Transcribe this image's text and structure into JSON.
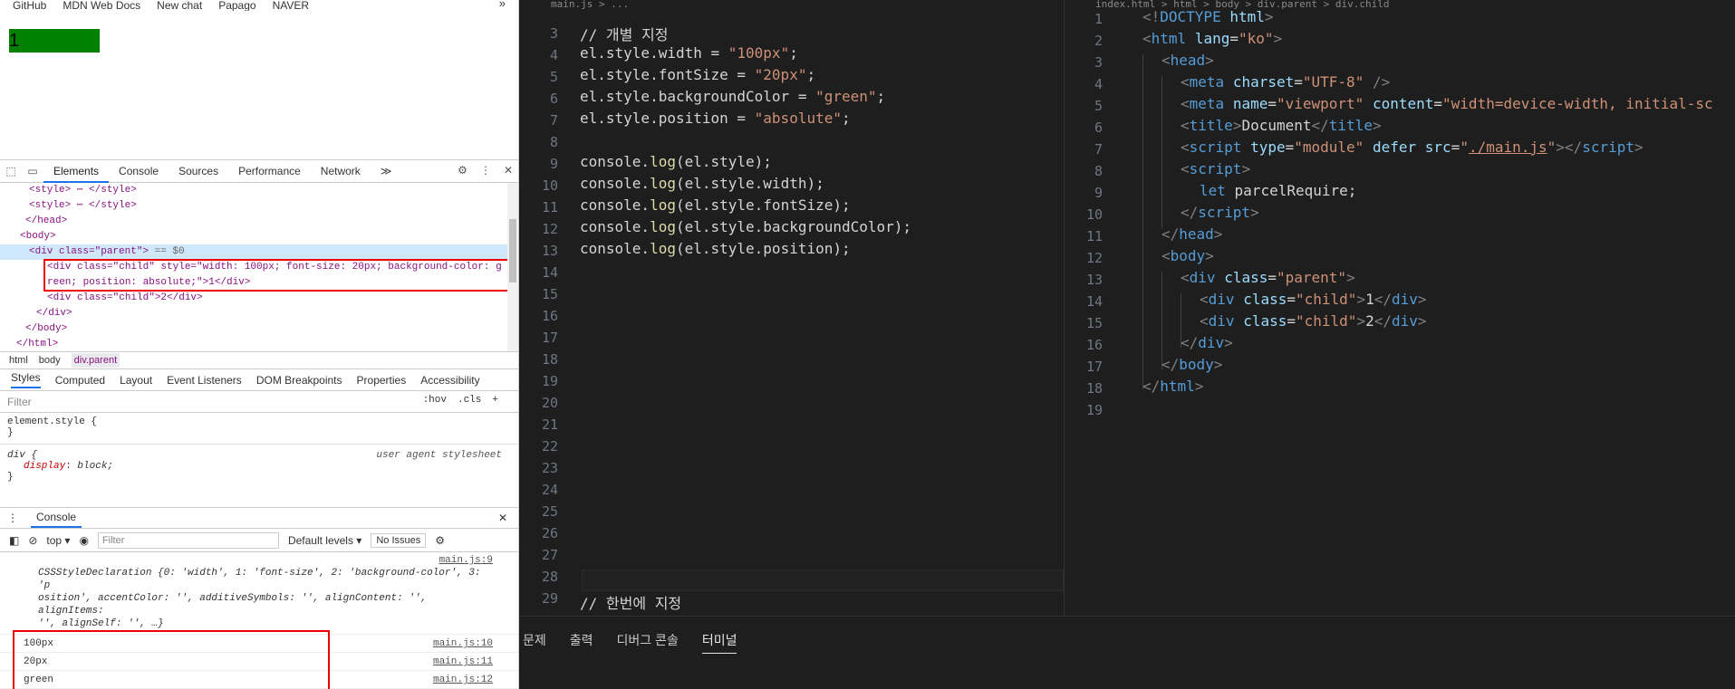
{
  "bookmarks": [
    "GitHub",
    "MDN Web Docs",
    "New chat",
    "Papago",
    "NAVER"
  ],
  "bookmarks_more": "»",
  "preview": {
    "child1": "1"
  },
  "devtools": {
    "tabs": [
      "Elements",
      "Console",
      "Sources",
      "Performance",
      "Network"
    ],
    "tabs_more": "≫",
    "dom": {
      "l1": "<style> ⋯ </style>",
      "l2": "<style> ⋯ </style>",
      "l3": "</head>",
      "l4": "<body>",
      "l5_tag": "<div class=\"parent\">",
      "l5_suffix": " == $0",
      "l6a": "<div class=\"child\" style=\"width: 100px; font-size: 20px; background-color: g",
      "l6b": "reen; position: absolute;\">1</div>",
      "l7": "<div class=\"child\">2</div>",
      "l8": "</div>",
      "l9": "</body>",
      "l10": "</html>"
    },
    "breadcrumbs": [
      "html",
      "body",
      "div.parent"
    ],
    "style_tabs": [
      "Styles",
      "Computed",
      "Layout",
      "Event Listeners",
      "DOM Breakpoints",
      "Properties",
      "Accessibility"
    ],
    "filter_placeholder": "Filter",
    "filter_tools": [
      ":hov",
      ".cls",
      "+"
    ],
    "rules": {
      "r1": "element.style {",
      "r1c": "}",
      "r2": "div {",
      "r2src": "user agent stylesheet",
      "r2prop": "display",
      "r2val": "block;",
      "r2c": "}"
    },
    "console_tab": "Console",
    "console_tools": {
      "context": "top ▾",
      "filter": "Filter",
      "levels": "Default levels ▾",
      "issues": "No Issues"
    },
    "log": {
      "obj_src": "main.js:9",
      "obj_text1": "CSSStyleDeclaration {0: 'width', 1: 'font-size', 2: 'background-color', 3: 'p",
      "obj_text2": "osition', accentColor: '', additiveSymbols: '', alignContent: '', alignItems:",
      "obj_text3": "'', alignSelf: '', …}",
      "rows": [
        {
          "value": "100px",
          "src": "main.js:10"
        },
        {
          "value": "20px",
          "src": "main.js:11"
        },
        {
          "value": "green",
          "src": "main.js:12"
        },
        {
          "value": "absolute",
          "src": "main.js:13"
        }
      ]
    }
  },
  "editor_left": {
    "header": "main.js > ...",
    "line_numbers": [
      "3",
      "4",
      "5",
      "6",
      "7",
      "8",
      "9",
      "10",
      "11",
      "12",
      "13",
      "14",
      "15",
      "16",
      "17",
      "18",
      "19",
      "20",
      "21",
      "22",
      "23",
      "24",
      "25",
      "26",
      "27",
      "28",
      "29"
    ],
    "comment1": "// 개별 지정",
    "comment2": "// 한번에 지정"
  },
  "editor_right": {
    "header": "index.html > html > body > div.parent > div.child",
    "line_numbers": [
      "1",
      "2",
      "3",
      "4",
      "5",
      "6",
      "7",
      "8",
      "9",
      "10",
      "11",
      "12",
      "13",
      "14",
      "15",
      "16",
      "17",
      "18",
      "19"
    ]
  },
  "panel_tabs": [
    "문제",
    "출력",
    "디버그 콘솔",
    "터미널"
  ]
}
